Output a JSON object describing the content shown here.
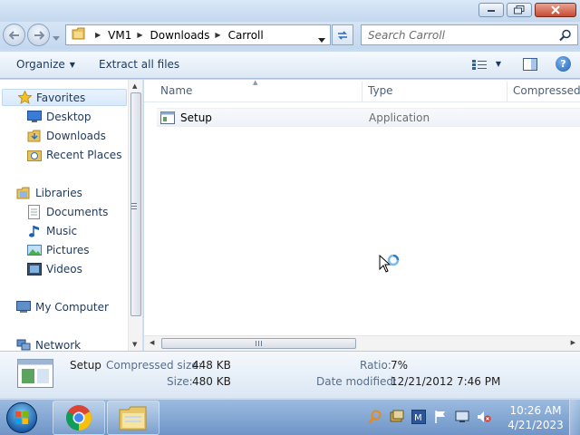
{
  "window": {
    "controls": {
      "minimize": "minimize",
      "maximize": "maximize",
      "close": "close"
    }
  },
  "address": {
    "crumbs": [
      "VM1",
      "Downloads",
      "Carroll"
    ],
    "search_placeholder": "Search Carroll"
  },
  "toolbar": {
    "organize": "Organize",
    "extract_all": "Extract all files"
  },
  "nav": {
    "favorites": {
      "label": "Favorites",
      "items": [
        "Desktop",
        "Downloads",
        "Recent Places"
      ]
    },
    "libraries": {
      "label": "Libraries",
      "items": [
        "Documents",
        "Music",
        "Pictures",
        "Videos"
      ]
    },
    "computer": "My Computer",
    "network": "Network"
  },
  "filelist": {
    "columns": {
      "name": "Name",
      "type": "Type",
      "compressed": "Compressed s"
    },
    "files": [
      {
        "name": "Setup",
        "type": "Application"
      }
    ]
  },
  "details": {
    "name": "Setup",
    "compressed_label": "Compressed size:",
    "compressed_value": "448 KB",
    "size_label": "Size:",
    "size_value": "480 KB",
    "ratio_label": "Ratio:",
    "ratio_value": "7%",
    "modified_label": "Date modified:",
    "modified_value": "12/21/2012 7:46 PM"
  },
  "taskbar": {
    "time": "10:26 AM",
    "date": "4/21/2023",
    "apps": [
      "chrome",
      "windows-explorer"
    ],
    "tray_icons": [
      "search-icon",
      "network-tool-icon",
      "word-icon",
      "flag-icon",
      "monitor-icon",
      "volume-muted-icon"
    ]
  },
  "colors": {
    "accent": "#1e395b",
    "selection": "#d9e9fb",
    "taskbar": "#6f95c7"
  }
}
